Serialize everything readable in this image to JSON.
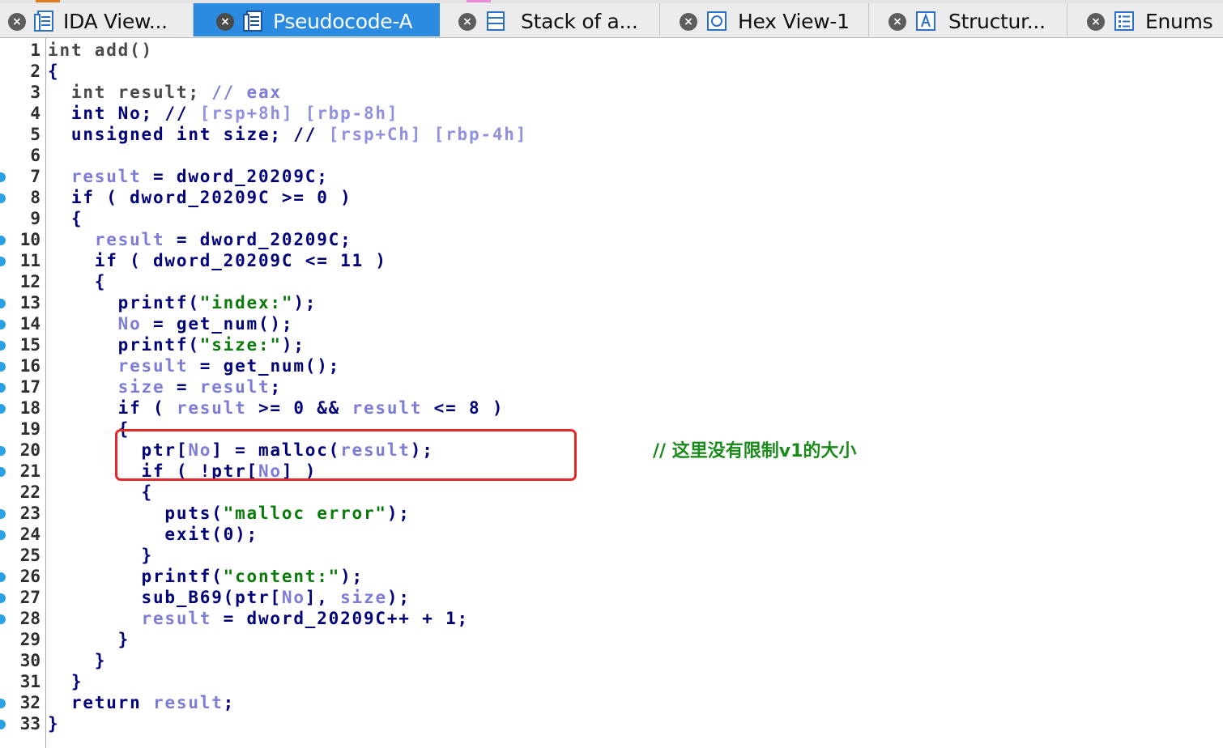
{
  "tabs": [
    {
      "label": "IDA View...",
      "icon": "ida-view-icon",
      "active": false
    },
    {
      "label": "Pseudocode-A",
      "icon": "pseudocode-icon",
      "active": true
    },
    {
      "label": "Stack of a...",
      "icon": "stack-icon",
      "active": false
    },
    {
      "label": "Hex View-1",
      "icon": "hex-view-icon",
      "active": false
    },
    {
      "label": "Structur...",
      "icon": "structures-icon",
      "active": false
    },
    {
      "label": "Enums",
      "icon": "enums-icon",
      "active": false
    }
  ],
  "colors": {
    "active_tab": "#2b8be0",
    "keyword": "#00007a",
    "variable": "#7d7dd6",
    "string_comment": "#0a7a0a",
    "breakpoint_dot": "#2aa1e6",
    "highlight_box": "#e5262a"
  },
  "code": [
    {
      "n": "1",
      "dot": false,
      "tokens": [
        [
          "int add()",
          "plain"
        ]
      ]
    },
    {
      "n": "2",
      "dot": false,
      "tokens": [
        [
          "{",
          "kw"
        ]
      ]
    },
    {
      "n": "3",
      "dot": false,
      "tokens": [
        [
          "  int result; ",
          "plain"
        ],
        [
          "// eax",
          "var"
        ]
      ]
    },
    {
      "n": "4",
      "dot": false,
      "tokens": [
        [
          "  int No; // ",
          "kw"
        ],
        [
          "[rsp+8h] [rbp-8h]",
          "addr"
        ]
      ]
    },
    {
      "n": "5",
      "dot": false,
      "tokens": [
        [
          "  unsigned int size; // ",
          "kw"
        ],
        [
          "[rsp+Ch] [rbp-4h]",
          "addr"
        ]
      ]
    },
    {
      "n": "6",
      "dot": false,
      "tokens": []
    },
    {
      "n": "7",
      "dot": true,
      "tokens": [
        [
          "  ",
          "kw"
        ],
        [
          "result",
          "var"
        ],
        [
          " = dword_20209C;",
          "kw"
        ]
      ]
    },
    {
      "n": "8",
      "dot": true,
      "tokens": [
        [
          "  if ( dword_20209C >= 0 )",
          "kw"
        ]
      ]
    },
    {
      "n": "9",
      "dot": false,
      "tokens": [
        [
          "  {",
          "kw"
        ]
      ]
    },
    {
      "n": "10",
      "dot": true,
      "tokens": [
        [
          "    ",
          "kw"
        ],
        [
          "result",
          "var"
        ],
        [
          " = dword_20209C;",
          "kw"
        ]
      ]
    },
    {
      "n": "11",
      "dot": true,
      "tokens": [
        [
          "    if ( dword_20209C <= 11 )",
          "kw"
        ]
      ]
    },
    {
      "n": "12",
      "dot": false,
      "tokens": [
        [
          "    {",
          "kw"
        ]
      ]
    },
    {
      "n": "13",
      "dot": true,
      "tokens": [
        [
          "      printf(",
          "kw"
        ],
        [
          "\"index:\"",
          "str"
        ],
        [
          ");",
          "kw"
        ]
      ]
    },
    {
      "n": "14",
      "dot": true,
      "tokens": [
        [
          "      ",
          "kw"
        ],
        [
          "No",
          "var"
        ],
        [
          " = get_num();",
          "kw"
        ]
      ]
    },
    {
      "n": "15",
      "dot": true,
      "tokens": [
        [
          "      printf(",
          "kw"
        ],
        [
          "\"size:\"",
          "str"
        ],
        [
          ");",
          "kw"
        ]
      ]
    },
    {
      "n": "16",
      "dot": true,
      "tokens": [
        [
          "      ",
          "kw"
        ],
        [
          "result",
          "var"
        ],
        [
          " = get_num();",
          "kw"
        ]
      ]
    },
    {
      "n": "17",
      "dot": true,
      "tokens": [
        [
          "      ",
          "kw"
        ],
        [
          "size",
          "var"
        ],
        [
          " = ",
          "kw"
        ],
        [
          "result",
          "var"
        ],
        [
          ";",
          "kw"
        ]
      ]
    },
    {
      "n": "18",
      "dot": true,
      "tokens": [
        [
          "      if ( ",
          "kw"
        ],
        [
          "result",
          "var"
        ],
        [
          " >= 0 && ",
          "kw"
        ],
        [
          "result",
          "var"
        ],
        [
          " <= 8 )",
          "kw"
        ]
      ]
    },
    {
      "n": "19",
      "dot": false,
      "tokens": [
        [
          "      {",
          "kw"
        ]
      ]
    },
    {
      "n": "20",
      "dot": true,
      "tokens": [
        [
          "        ptr[",
          "kw"
        ],
        [
          "No",
          "var"
        ],
        [
          "] = malloc(",
          "kw"
        ],
        [
          "result",
          "var"
        ],
        [
          ");",
          "kw"
        ]
      ]
    },
    {
      "n": "21",
      "dot": true,
      "tokens": [
        [
          "        if ( !ptr[",
          "kw"
        ],
        [
          "No",
          "var"
        ],
        [
          "] )",
          "kw"
        ]
      ]
    },
    {
      "n": "22",
      "dot": false,
      "tokens": [
        [
          "        {",
          "kw"
        ]
      ]
    },
    {
      "n": "23",
      "dot": true,
      "tokens": [
        [
          "          puts(",
          "kw"
        ],
        [
          "\"malloc error\"",
          "str"
        ],
        [
          ");",
          "kw"
        ]
      ]
    },
    {
      "n": "24",
      "dot": true,
      "tokens": [
        [
          "          exit(0);",
          "kw"
        ]
      ]
    },
    {
      "n": "25",
      "dot": false,
      "tokens": [
        [
          "        }",
          "kw"
        ]
      ]
    },
    {
      "n": "26",
      "dot": true,
      "tokens": [
        [
          "        printf(",
          "kw"
        ],
        [
          "\"content:\"",
          "str"
        ],
        [
          ");",
          "kw"
        ]
      ]
    },
    {
      "n": "27",
      "dot": true,
      "tokens": [
        [
          "        sub_B69(ptr[",
          "kw"
        ],
        [
          "No",
          "var"
        ],
        [
          "], ",
          "kw"
        ],
        [
          "size",
          "var"
        ],
        [
          ");",
          "kw"
        ]
      ]
    },
    {
      "n": "28",
      "dot": true,
      "tokens": [
        [
          "        ",
          "kw"
        ],
        [
          "result",
          "var"
        ],
        [
          " = dword_20209C++ + 1;",
          "kw"
        ]
      ]
    },
    {
      "n": "29",
      "dot": false,
      "tokens": [
        [
          "      }",
          "kw"
        ]
      ]
    },
    {
      "n": "30",
      "dot": false,
      "tokens": [
        [
          "    }",
          "kw"
        ]
      ]
    },
    {
      "n": "31",
      "dot": false,
      "tokens": [
        [
          "  }",
          "kw"
        ]
      ]
    },
    {
      "n": "32",
      "dot": true,
      "tokens": [
        [
          "  return ",
          "kw"
        ],
        [
          "result",
          "var"
        ],
        [
          ";",
          "kw"
        ]
      ]
    },
    {
      "n": "33",
      "dot": true,
      "tokens": [
        [
          "}",
          "kw"
        ]
      ]
    }
  ],
  "annotation": {
    "text": "// 这里没有限制v1的大小"
  }
}
